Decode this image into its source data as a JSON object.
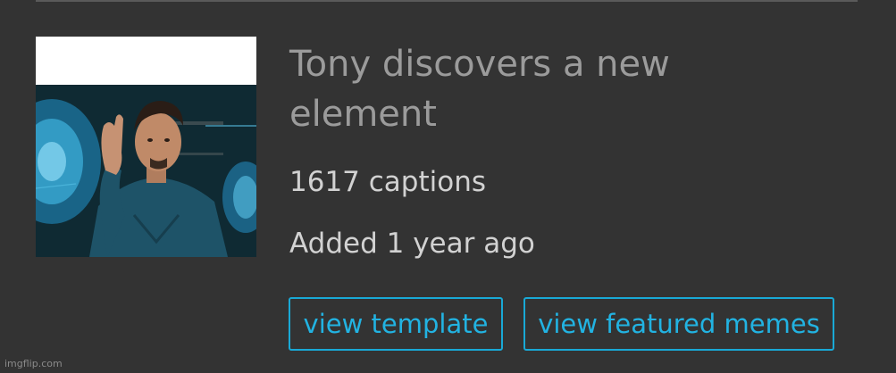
{
  "template": {
    "title": "Tony discovers a new element",
    "captions": "1617 captions",
    "added": "Added 1 year ago"
  },
  "actions": {
    "view_template": "view template",
    "view_featured": "view featured memes"
  },
  "footer": {
    "watermark": "imgflip.com"
  },
  "colors": {
    "background": "#333333",
    "accent": "#22b3e2",
    "title_text": "#9b9b9b",
    "body_text": "#d2d2d2"
  }
}
